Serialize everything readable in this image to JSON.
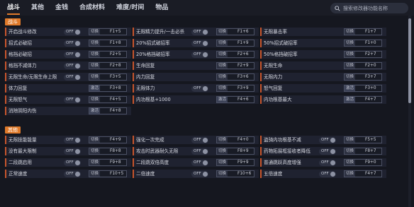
{
  "tabs": [
    "战斗",
    "其他",
    "金钱",
    "合成材料",
    "难度/时间",
    "物品"
  ],
  "search": {
    "placeholder": "搜索修改器功能名称"
  },
  "sections": {
    "battle": "战斗",
    "other": "其他"
  },
  "toggle_text": "OFF",
  "switch_text": "切换",
  "activate_text": "激活",
  "battle_rows": [
    [
      {
        "label": "开启战斗修改",
        "type": "toggle",
        "key": "F1+5"
      },
      {
        "label": "无限精力提升/一击必杀",
        "type": "toggle",
        "key": "F1+6"
      },
      {
        "label": "无限暴击率",
        "type": "none",
        "key": "F1+7"
      }
    ],
    [
      {
        "label": "招式必破招",
        "type": "toggle",
        "key": "F1+8"
      },
      {
        "label": "20%招式破招率",
        "type": "toggle",
        "key": "F1+9"
      },
      {
        "label": "50%招式破招率",
        "type": "none",
        "key": "F1+0"
      }
    ],
    [
      {
        "label": "格挡必破招",
        "type": "toggle",
        "key": "F2+5"
      },
      {
        "label": "20%格挡破招率",
        "type": "toggle",
        "key": "F2+6"
      },
      {
        "label": "50%格挡破招率",
        "type": "none",
        "key": "F2+7"
      }
    ],
    [
      {
        "label": "格挡不减体力",
        "type": "toggle",
        "key": "F2+8"
      },
      {
        "label": "生命回复",
        "type": "none",
        "key": "F2+9"
      },
      {
        "label": "无限生命",
        "type": "none",
        "key": "F2+0"
      }
    ],
    [
      {
        "label": "无限生命/无限生命上限",
        "type": "toggle",
        "key": "F3+5"
      },
      {
        "label": "内力回复",
        "type": "none",
        "key": "F3+6"
      },
      {
        "label": "无限内力",
        "type": "none",
        "key": "F3+7"
      }
    ],
    [
      {
        "label": "体力回复",
        "type": "activate",
        "key": "F3+8"
      },
      {
        "label": "无限体力",
        "type": "toggle",
        "key": "F3+9"
      },
      {
        "label": "怒气回复",
        "type": "activate",
        "key": "F3+0"
      }
    ],
    [
      {
        "label": "无限怒气",
        "type": "toggle",
        "key": "F4+5"
      },
      {
        "label": "内功根基+1000",
        "type": "activate",
        "key": "F4+6"
      },
      {
        "label": "内功根基最大",
        "type": "activate",
        "key": "F4+7"
      }
    ],
    [
      {
        "label": "消除阴阳内伤",
        "type": "activate",
        "key": "F4+8"
      }
    ]
  ],
  "other_rows": [
    [
      {
        "label": "无限技能能量",
        "type": "toggle",
        "key": "F4+9"
      },
      {
        "label": "强化一次完成",
        "type": "toggle",
        "key": "F4+0"
      },
      {
        "label": "盗骑内功根基不减",
        "type": "toggle",
        "key": "F5+5"
      }
    ],
    [
      {
        "label": "没有最大限制",
        "type": "toggle",
        "key": "F8+8"
      },
      {
        "label": "攻击时武器耐久无限",
        "type": "toggle",
        "key": "F8+9"
      },
      {
        "label": "药物拓展框接收者降低",
        "type": "toggle",
        "key": "F8+7"
      }
    ],
    [
      {
        "label": "二段跳启用",
        "type": "toggle",
        "key": "F9+8"
      },
      {
        "label": "二段跳双倍高度",
        "type": "toggle",
        "key": "F9+9"
      },
      {
        "label": "普通跳跃高度增强",
        "type": "toggle",
        "key": "F9+0"
      }
    ],
    [
      {
        "label": "正常速度",
        "type": "toggle",
        "key": "F10+5"
      },
      {
        "label": "二倍速度",
        "type": "toggle",
        "key": "F10+6"
      },
      {
        "label": "五倍速度",
        "type": "toggle",
        "key": "F4+7"
      }
    ]
  ]
}
